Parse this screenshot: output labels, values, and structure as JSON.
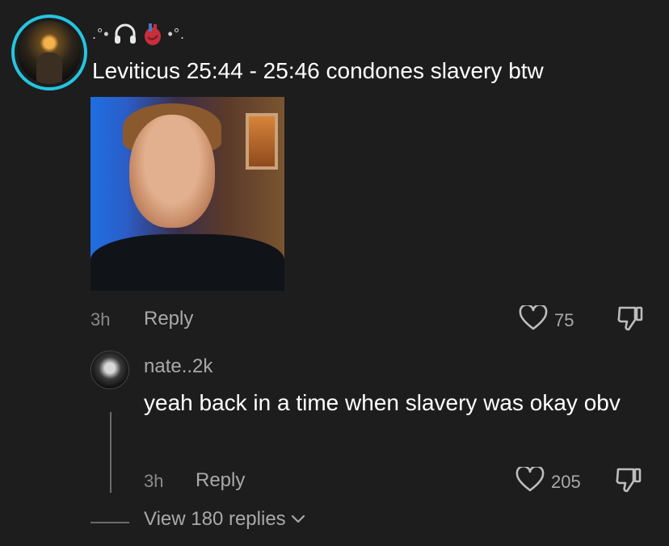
{
  "top_comment": {
    "username": ".°•🎧❤•°.",
    "username_parts": {
      "left": ".°•",
      "mid": "🎧",
      "heart": "🫀",
      "right": "•°."
    },
    "text": "Leviticus 25:44 - 25:46 condones slavery btw",
    "image_alt": "reaction image",
    "time": "3h",
    "reply_label": "Reply",
    "like_count": "75"
  },
  "reply_comment": {
    "username": "nate..2k",
    "text": "yeah back in a time when slavery was okay obv",
    "time": "3h",
    "reply_label": "Reply",
    "like_count": "205"
  },
  "view_replies": {
    "label": "View 180 replies"
  },
  "colors": {
    "background": "#1d1d1d",
    "avatar_ring": "#25c5e0",
    "muted": "#a9a9a9"
  },
  "icons": [
    "heart-outline-icon",
    "dislike-icon",
    "chevron-down-icon"
  ]
}
